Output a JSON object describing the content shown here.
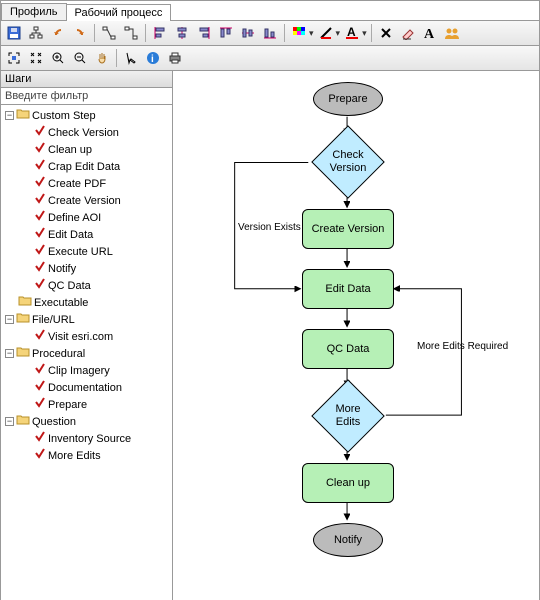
{
  "tabs": {
    "profile": "Профиль",
    "workflow": "Рабочий процесс"
  },
  "panel": {
    "title": "Шаги",
    "filter_placeholder": "Введите фильтр"
  },
  "tree": {
    "custom_step": "Custom Step",
    "custom_steps": [
      "Check Version",
      "Clean up",
      "Crap Edit Data",
      "Create PDF",
      "Create Version",
      "Define AOI",
      "Edit Data",
      "Execute URL",
      "Notify",
      "QC Data"
    ],
    "executable": "Executable",
    "file_url": "File/URL",
    "file_url_items": [
      "Visit esri.com"
    ],
    "procedural": "Procedural",
    "procedural_items": [
      "Clip Imagery",
      "Documentation",
      "Prepare"
    ],
    "question": "Question",
    "question_items": [
      "Inventory Source",
      "More Edits"
    ]
  },
  "toolbar1": {
    "icons": [
      "save",
      "tree",
      "undo",
      "redo",
      "sep",
      "connector1",
      "connector2",
      "sep",
      "align-left",
      "align-center",
      "align-right",
      "align-top",
      "align-middle",
      "align-bottom",
      "sep",
      "fill",
      "line-color",
      "font-color",
      "sep",
      "delete",
      "clear",
      "font",
      "users"
    ]
  },
  "toolbar2": {
    "icons": [
      "fit",
      "extent",
      "zoom-in",
      "zoom-out",
      "pan",
      "sep",
      "select",
      "info",
      "print"
    ]
  },
  "nodes": {
    "prepare": "Prepare",
    "check_version": "Check\nVersion",
    "create_version": "Create Version",
    "edit_data": "Edit Data",
    "qc_data": "QC Data",
    "more_edits": "More\nEdits",
    "clean_up": "Clean up",
    "notify": "Notify"
  },
  "edge_labels": {
    "version_exists": "Version Exists",
    "more_edits_required": "More Edits Required"
  },
  "colors": {
    "rect": "#b6f0b6",
    "diamond": "#c0ecff",
    "ellipse": "#bbbbbb"
  }
}
